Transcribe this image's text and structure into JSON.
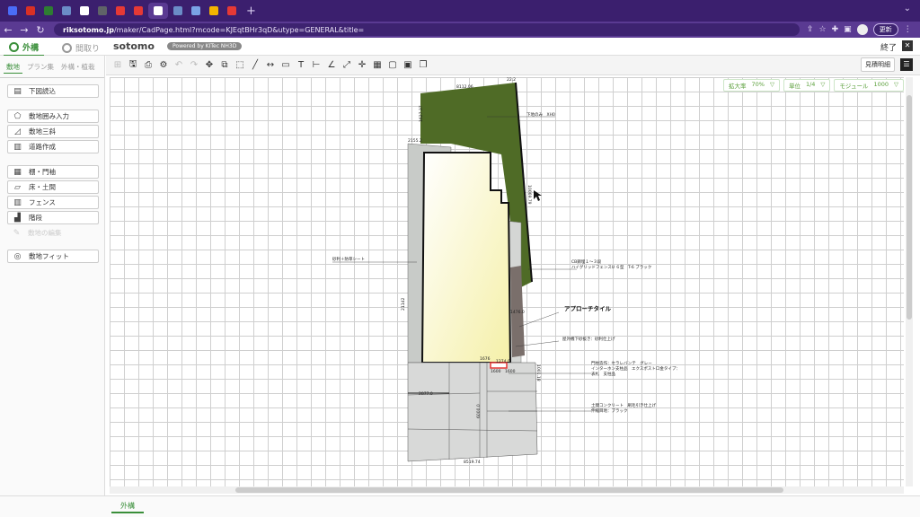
{
  "browser": {
    "tabs": [
      {
        "color": "#4a6cf7"
      },
      {
        "color": "#d93025"
      },
      {
        "color": "#2e7d32"
      },
      {
        "color": "#6b8cc7"
      },
      {
        "color": "#ffffff"
      },
      {
        "color": "#5f6368"
      },
      {
        "color": "#e53935"
      },
      {
        "color": "#e53935"
      },
      {
        "color": "#ffffff"
      },
      {
        "color": "#6b8cc7"
      },
      {
        "color": "#7aa3e5"
      },
      {
        "color": "#f4b400"
      },
      {
        "color": "#e53935"
      }
    ],
    "new_tab": "+",
    "url_host": "riksotomo.jp",
    "url_path": "/maker/CadPage.html?mcode=KJEqtBHr3qD&utype=GENERAL&title=",
    "update_label": "更新"
  },
  "app": {
    "mode_tabs": [
      {
        "label": "外構"
      },
      {
        "label": "間取り"
      }
    ],
    "logo": "sotomo",
    "powered": "Powered by KITec NH3D",
    "exit_label": "終了",
    "estimate_label": "見積明細"
  },
  "sidebar": {
    "subtabs": [
      "敷地",
      "プラン集",
      "外構・植栽"
    ],
    "buttons": [
      {
        "label": "下図読込",
        "icon": "image-icon"
      },
      {
        "label": "敷地囲み入力",
        "icon": "polygon-icon"
      },
      {
        "label": "敷地三斜",
        "icon": "triangle-icon"
      },
      {
        "label": "道路作成",
        "icon": "road-icon"
      },
      {
        "label": "棚・門袖",
        "icon": "wall-icon"
      },
      {
        "label": "床・土間",
        "icon": "floor-icon"
      },
      {
        "label": "フェンス",
        "icon": "fence-icon"
      },
      {
        "label": "階段",
        "icon": "stairs-icon"
      },
      {
        "label": "敷地の編集",
        "icon": "edit-icon"
      },
      {
        "label": "敷地フィット",
        "icon": "fit-icon"
      }
    ]
  },
  "view": {
    "zoom_label": "拡大率",
    "zoom_value": "70%",
    "unit_label": "単位",
    "unit_value": "1/4",
    "module_label": "モジュール",
    "module_value": "1000"
  },
  "cad": {
    "labels": {
      "top_dim1": "8112.06",
      "top_dim2": "22.2",
      "lawn": "下地のみ　XH0",
      "left_top_dim": "2155.2",
      "left_dim_v": "21142",
      "right_dim_v": "10069.79",
      "gravel": "砂利＋防草シート",
      "fence1": "CB鋼埋１〜３段",
      "fence2": "ハイグリッドフェンスU ６型　T-6 ブラック",
      "approach": "アプローチタイル",
      "approach_dim": "1476.0",
      "walkway": "屋外機下砂抜き：砂利仕上げ",
      "dim_1676": "1676",
      "dim_1274": "1274.0",
      "dim_1600": "1600",
      "dim_1600b": "1600",
      "gate1": "門柱造作：セラレバンテ　グレー",
      "gate2": "インターホン支柱品　エクスポストロ金タイプ：",
      "gate3": "表札　支柱品",
      "concrete1": "土間コンクリート　刷毛引き仕上げ",
      "concrete2": "伸縮目地：ブラック",
      "dim_2877": "2877.0",
      "dim_6000": "6000.0",
      "right_dim2": "1001.18",
      "bottom_dim": "8519.74",
      "upper_dim_v": "1627.37"
    }
  },
  "bottom": {
    "tab": "外構"
  }
}
